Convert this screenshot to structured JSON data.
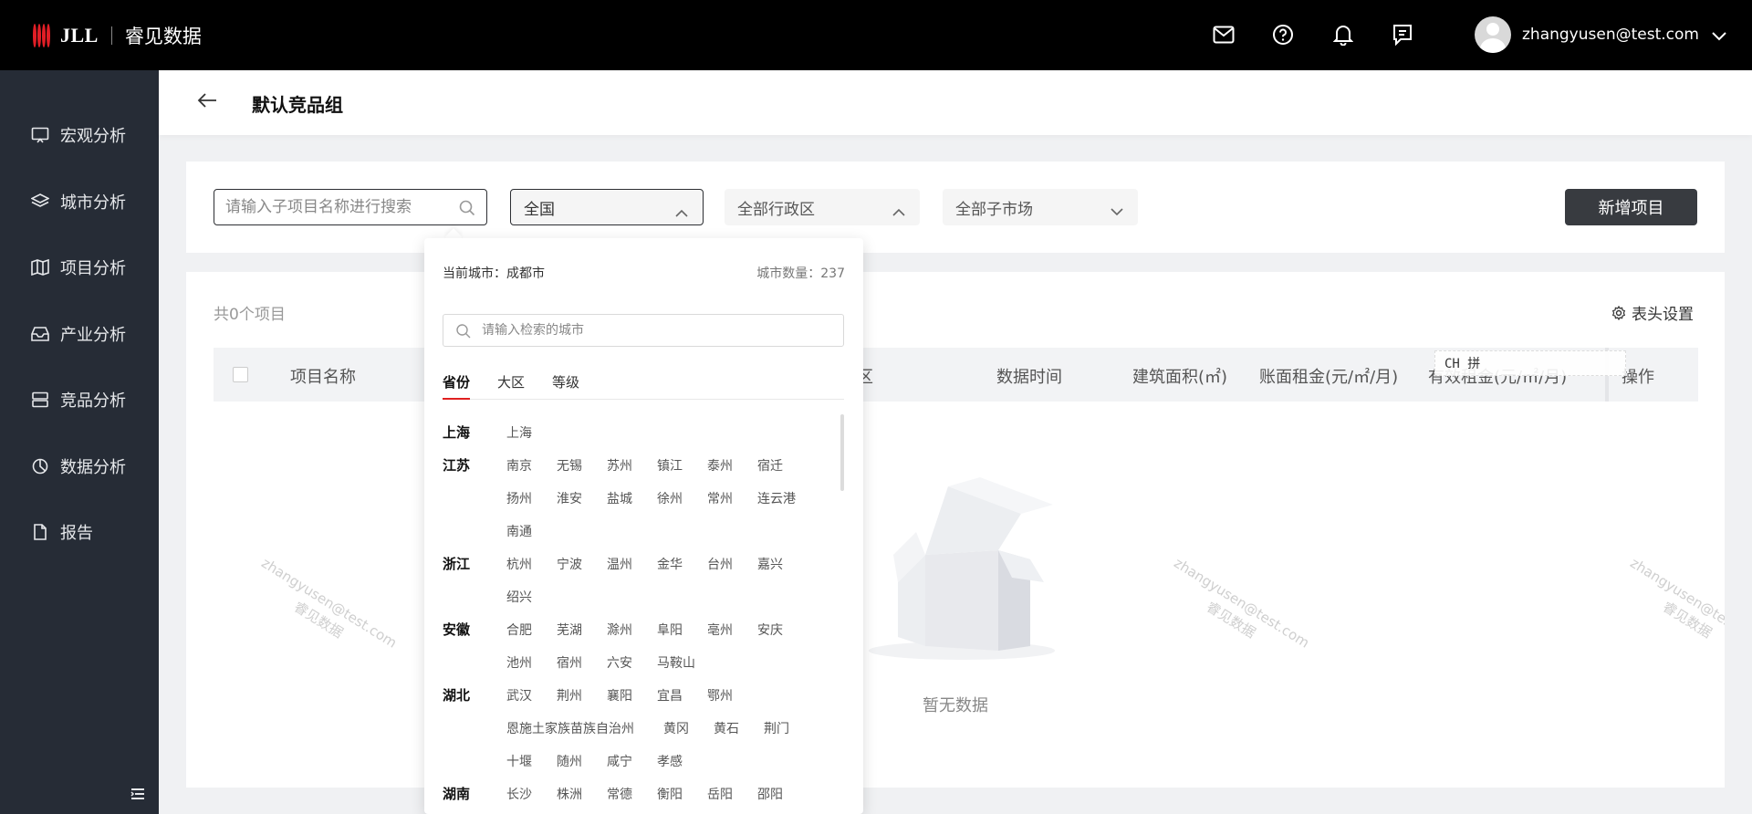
{
  "header": {
    "logo_text": "JLL",
    "product_name": "睿见数据",
    "icons": [
      "mail-icon",
      "help-icon",
      "bell-icon",
      "message-icon"
    ],
    "user_email": "zhangyusen@test.com"
  },
  "sidebar": {
    "items": [
      {
        "label": "宏观分析",
        "icon": "monitor-icon"
      },
      {
        "label": "城市分析",
        "icon": "layers-icon"
      },
      {
        "label": "项目分析",
        "icon": "map-icon"
      },
      {
        "label": "产业分析",
        "icon": "inbox-icon"
      },
      {
        "label": "竞品分析",
        "icon": "server-icon"
      },
      {
        "label": "数据分析",
        "icon": "pie-icon"
      },
      {
        "label": "报告",
        "icon": "file-icon"
      }
    ]
  },
  "page": {
    "title": "默认竞品组"
  },
  "filters": {
    "search_placeholder": "请输入子项目名称进行搜索",
    "region_value": "全国",
    "district_value": "全部行政区",
    "market_value": "全部子市场",
    "add_button": "新增项目"
  },
  "table": {
    "count_text": "共0个项目",
    "settings_label": "表头设置",
    "columns": [
      "项目名称",
      "区",
      "数据时间",
      "建筑面积(㎡)",
      "账面租金(元/㎡/月)",
      "有效租金(元/㎡/月)",
      "操作"
    ],
    "empty_text": "暂无数据",
    "watermark_email": "zhangyusen@test.com",
    "watermark_brand": "睿见数据",
    "ime_text": "CH 拼"
  },
  "city_dropdown": {
    "current_city": "当前城市：成都市",
    "city_count": "城市数量：237",
    "search_placeholder": "请输入检索的城市",
    "tabs": [
      "省份",
      "大区",
      "等级"
    ],
    "active_tab": "省份",
    "provinces": [
      {
        "name": "上海",
        "rows": [
          [
            "上海"
          ]
        ]
      },
      {
        "name": "江苏",
        "rows": [
          [
            "南京",
            "无锡",
            "苏州",
            "镇江",
            "泰州",
            "宿迁"
          ],
          [
            "扬州",
            "淮安",
            "盐城",
            "徐州",
            "常州",
            "连云港"
          ],
          [
            "南通"
          ]
        ]
      },
      {
        "name": "浙江",
        "rows": [
          [
            "杭州",
            "宁波",
            "温州",
            "金华",
            "台州",
            "嘉兴"
          ],
          [
            "绍兴"
          ]
        ]
      },
      {
        "name": "安徽",
        "rows": [
          [
            "合肥",
            "芜湖",
            "滁州",
            "阜阳",
            "亳州",
            "安庆"
          ],
          [
            "池州",
            "宿州",
            "六安",
            "马鞍山"
          ]
        ]
      },
      {
        "name": "湖北",
        "rows": [
          [
            "武汉",
            "荆州",
            "襄阳",
            "宜昌",
            "鄂州"
          ],
          [
            "恩施土家族苗族自治州",
            "黄冈",
            "黄石",
            "荆门"
          ],
          [
            "十堰",
            "随州",
            "咸宁",
            "孝感"
          ]
        ]
      },
      {
        "name": "湖南",
        "rows": [
          [
            "长沙",
            "株洲",
            "常德",
            "衡阳",
            "岳阳",
            "邵阳"
          ]
        ]
      }
    ]
  }
}
